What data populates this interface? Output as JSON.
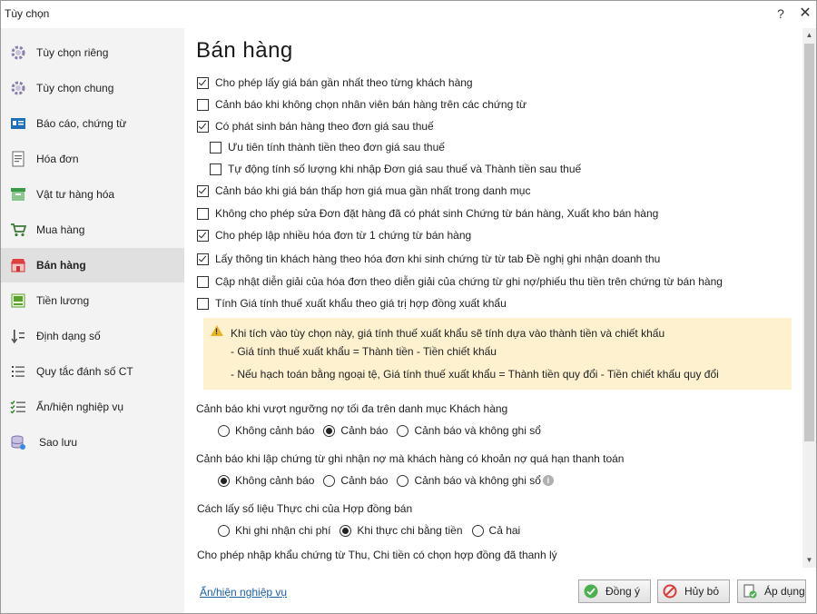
{
  "window": {
    "title": "Tùy chọn",
    "help": "?",
    "close": "✕"
  },
  "sidebar": {
    "items": [
      {
        "label": "Tùy chọn riêng",
        "icon": "gear-icon"
      },
      {
        "label": "Tùy chọn chung",
        "icon": "gear-icon"
      },
      {
        "label": "Báo cáo, chứng từ",
        "icon": "report-icon"
      },
      {
        "label": "Hóa đơn",
        "icon": "invoice-icon"
      },
      {
        "label": "Vật tư hàng hóa",
        "icon": "inventory-icon"
      },
      {
        "label": "Mua hàng",
        "icon": "cart-icon"
      },
      {
        "label": "Bán hàng",
        "icon": "store-icon",
        "active": true
      },
      {
        "label": "Tiền lương",
        "icon": "salary-icon"
      },
      {
        "label": "Định dạng số",
        "icon": "number-format-icon"
      },
      {
        "label": "Quy tắc đánh số CT",
        "icon": "numbering-rule-icon"
      },
      {
        "label": "Ẩn/hiện nghiệp vụ",
        "icon": "toggle-list-icon"
      },
      {
        "label": "Sao lưu",
        "icon": "database-icon"
      }
    ]
  },
  "main": {
    "heading": "Bán  hàng",
    "options": [
      {
        "label": "Cho phép lấy giá bán gần nhất theo từng khách hàng",
        "checked": true
      },
      {
        "label": "Cảnh báo khi không chọn nhân viên bán hàng trên các chứng từ",
        "checked": false
      },
      {
        "label": "Có phát sinh bán hàng theo đơn giá sau thuế",
        "checked": true
      },
      {
        "label": "Ưu tiên tính thành tiền theo đơn giá sau thuế",
        "checked": false,
        "indent": true
      },
      {
        "label": "Tự động tính số lượng khi nhập Đơn giá sau thuế và Thành tiền sau thuế",
        "checked": false,
        "indent": true
      },
      {
        "label": "Cảnh báo khi giá bán thấp hơn giá mua gần nhất trong danh mục",
        "checked": true
      },
      {
        "label": "Không cho phép sửa Đơn đặt hàng đã có phát sinh Chứng từ bán hàng, Xuất kho bán hàng",
        "checked": false
      },
      {
        "label": "Cho phép lập nhiều hóa đơn từ 1 chứng từ bán hàng",
        "checked": true
      },
      {
        "label": "Lấy thông tin khách hàng theo hóa đơn khi sinh chứng từ từ tab Đề nghị ghi nhận doanh thu",
        "checked": true
      },
      {
        "label": "Cập nhật diễn giải của hóa đơn theo diễn giải của chứng từ ghi nợ/phiếu thu tiền trên chứng từ bán hàng",
        "checked": false
      },
      {
        "label": "Tính Giá tính thuế xuất khẩu theo giá trị hợp đồng xuất khẩu",
        "checked": false
      }
    ],
    "note": {
      "line1": "Khi tích vào tùy chọn này, giá tính thuế xuất khẩu sẽ tính dựa vào thành tiền và chiết khấu",
      "line2": "- Giá tính thuế xuất khẩu = Thành tiền - Tiền chiết khấu",
      "line3": "- Nếu hạch toán bằng ngoại tệ, Giá tính thuế xuất khẩu = Thành tiền quy đổi - Tiền chiết khấu quy đổi"
    },
    "groups": [
      {
        "title": "Cảnh báo khi vượt ngưỡng nợ tối đa trên danh mục Khách hàng",
        "options": [
          "Không cảnh báo",
          "Cảnh báo",
          "Cảnh báo và không ghi sổ"
        ],
        "selected": 1
      },
      {
        "title": "Cảnh báo khi lập chứng từ ghi nhận nợ mà khách hàng có khoản nợ quá hạn thanh toán",
        "options": [
          "Không cảnh báo",
          "Cảnh báo",
          "Cảnh báo và không ghi sổ"
        ],
        "selected": 0,
        "info": "i"
      },
      {
        "title": "Cách lấy số liệu Thực chi của Hợp đồng bán",
        "options": [
          "Khi ghi nhận chi phí",
          "Khi thực chi bằng tiền",
          "Cả hai"
        ],
        "selected": 1
      }
    ],
    "last_option": "Cho phép nhập khẩu chứng từ Thu, Chi tiền có chọn hợp đồng đã thanh lý"
  },
  "footer": {
    "link": "Ẩn/hiện nghiệp vụ",
    "ok": "Đồng ý",
    "cancel": "Hủy bỏ",
    "apply": "Áp dụng"
  },
  "colors": {
    "note_bg": "#fdf1cf",
    "active_nav": "#e0e0e0",
    "link": "#1a5ea8"
  }
}
